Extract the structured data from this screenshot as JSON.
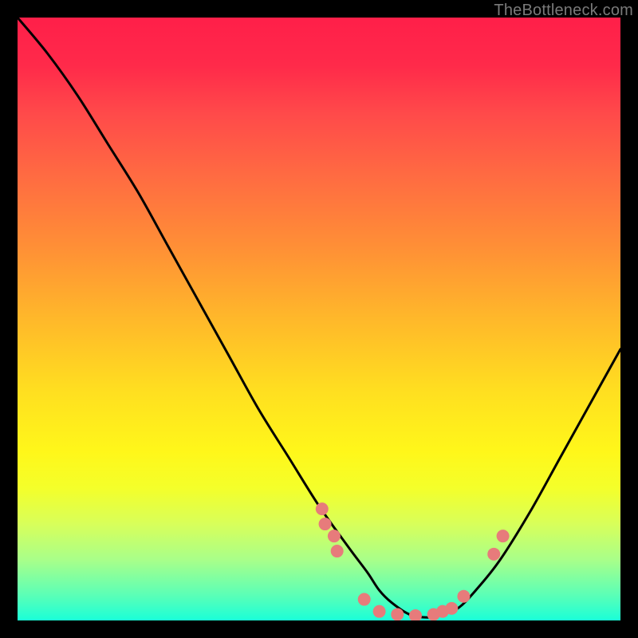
{
  "watermark": "TheBottleneck.com",
  "chart_data": {
    "type": "line",
    "title": "",
    "xlabel": "",
    "ylabel": "",
    "xlim": [
      0,
      100
    ],
    "ylim": [
      0,
      100
    ],
    "grid": false,
    "legend": false,
    "series": [
      {
        "name": "bottleneck-curve",
        "color": "#000000",
        "x": [
          0,
          5,
          10,
          15,
          20,
          25,
          30,
          35,
          40,
          45,
          50,
          55,
          58,
          60,
          62,
          65,
          68,
          70,
          73,
          76,
          80,
          85,
          90,
          95,
          100
        ],
        "y": [
          100,
          94,
          87,
          79,
          71,
          62,
          53,
          44,
          35,
          27,
          19,
          12,
          8,
          5,
          3,
          1,
          0.5,
          1,
          2,
          5,
          10,
          18,
          27,
          36,
          45
        ]
      }
    ],
    "points": {
      "name": "markers",
      "color": "#e77b7b",
      "x": [
        50.5,
        51.0,
        52.5,
        53.0,
        57.5,
        60.0,
        63.0,
        66.0,
        69.0,
        70.5,
        72.0,
        74.0,
        79.0,
        80.5
      ],
      "y": [
        18.5,
        16.0,
        14.0,
        11.5,
        3.5,
        1.5,
        1.0,
        0.8,
        1.0,
        1.5,
        2.0,
        4.0,
        11.0,
        14.0
      ]
    }
  }
}
